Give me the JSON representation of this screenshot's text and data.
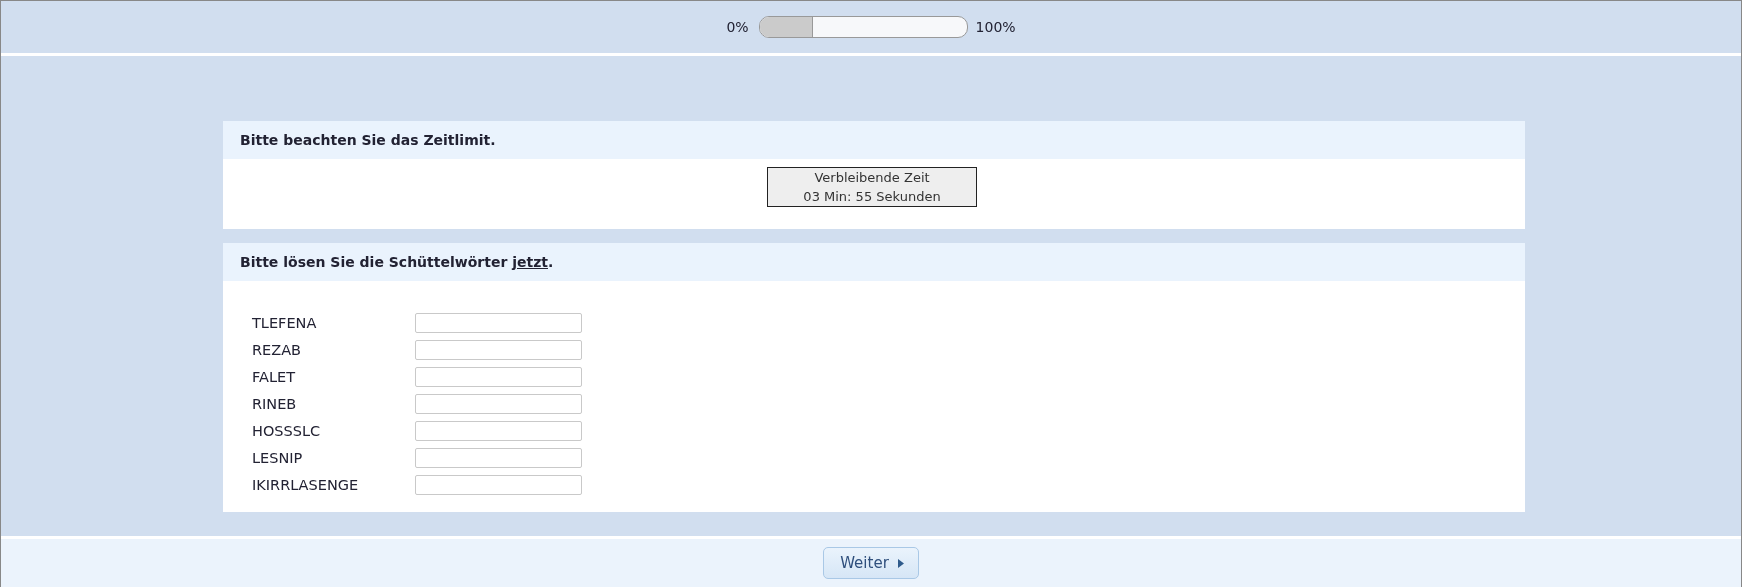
{
  "progress": {
    "min_label": "0%",
    "max_label": "100%",
    "level": 0.26
  },
  "time_panel": {
    "heading": "Bitte beachten Sie das Zeitlimit.",
    "timer_title": "Verbleibende Zeit",
    "timer_value": "03 Min: 55 Sekunden"
  },
  "word_panel": {
    "heading_before": "Bitte lösen Sie die Schüttelwörter",
    "heading_link": "jetzt",
    "heading_after": ".",
    "words": [
      {
        "label": "TLEFENA"
      },
      {
        "label": "REZAB"
      },
      {
        "label": "FALET"
      },
      {
        "label": "RINEB"
      },
      {
        "label": "HOSSSLC"
      },
      {
        "label": "LESNIP"
      },
      {
        "label": "IKIRRLASENGE"
      }
    ]
  },
  "next_button": {
    "label": "Weiter"
  }
}
